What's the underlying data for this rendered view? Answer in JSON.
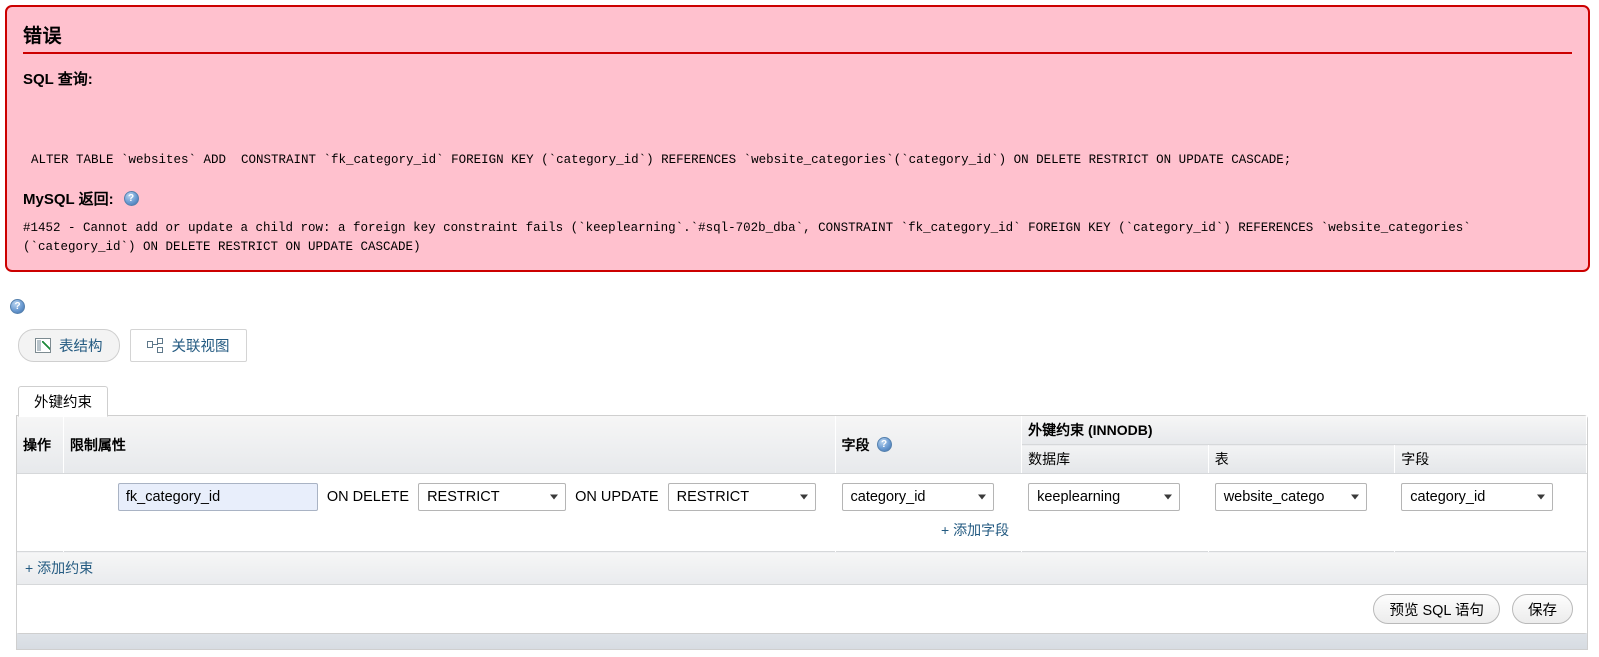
{
  "error_panel": {
    "title": "错误",
    "sql_query_label": "SQL 查询:",
    "sql_query": "ALTER TABLE `websites` ADD  CONSTRAINT `fk_category_id` FOREIGN KEY (`category_id`) REFERENCES `website_categories`(`category_id`) ON DELETE RESTRICT ON UPDATE CASCADE;",
    "mysql_return_label": "MySQL 返回:",
    "help_icon": "help-icon",
    "error_message": "#1452 - Cannot add or update a child row: a foreign key constraint fails (`keeplearning`.`#sql-702b_dba`, CONSTRAINT `fk_category_id` FOREIGN KEY (`category_id`) REFERENCES `website_categories` (`category_id`) ON DELETE RESTRICT ON UPDATE CASCADE)",
    "border_color": "#cc0000",
    "background_color": "#ffc1ce"
  },
  "page_help_icon": "help-icon",
  "tabs": [
    {
      "label": "表结构",
      "icon": "table-structure-icon",
      "active": true
    },
    {
      "label": "关联视图",
      "icon": "relation-view-icon",
      "active": false
    }
  ],
  "panel": {
    "tab_label": "外键约束",
    "headers": {
      "operation": "操作",
      "constraint_properties": "限制属性",
      "field": "字段",
      "field_help_icon": "help-icon",
      "foreign_key_group": "外键约束 (INNODB)",
      "sub_database": "数据库",
      "sub_table": "表",
      "sub_field": "字段"
    },
    "row": {
      "constraint_name": "fk_category_id",
      "on_delete_label": "ON DELETE",
      "on_delete_value": "RESTRICT",
      "on_update_label": "ON UPDATE",
      "on_update_value": "RESTRICT",
      "field_value": "category_id",
      "database_value": "keeplearning",
      "table_value": "website_catego",
      "target_field_value": "category_id",
      "add_field_link": "+ 添加字段"
    },
    "add_constraint_link": "+ 添加约束",
    "footer": {
      "preview_sql_label": "预览 SQL 语句",
      "save_label": "保存"
    }
  }
}
